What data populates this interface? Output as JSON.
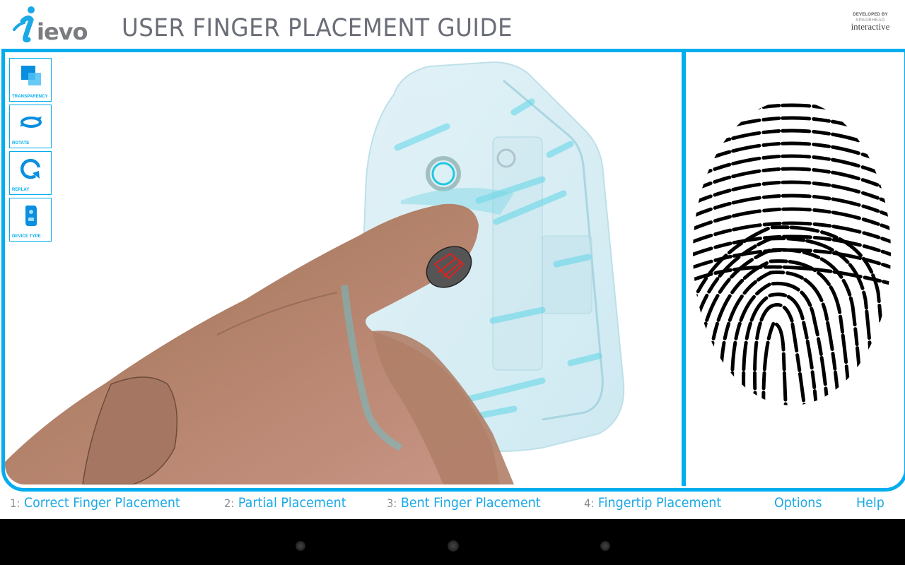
{
  "header": {
    "logo_text": "ievo",
    "title": "USER FINGER PLACEMENT GUIDE",
    "developer": {
      "line1": "DEVELOPED BY",
      "line2": "SPEARHEAD",
      "line3": "interactive"
    }
  },
  "toolbar": {
    "buttons": [
      {
        "label": "TRANSPARENCY",
        "icon": "transparency-icon"
      },
      {
        "label": "ROTATE",
        "icon": "rotate-icon"
      },
      {
        "label": "REPLAY",
        "icon": "replay-icon"
      },
      {
        "label": "DEVICE TYPE",
        "icon": "device-type-icon"
      }
    ]
  },
  "viewport": {
    "scene": "3D hand with index finger placed on transparent iEVO fingerprint reader",
    "print_panel": "fingerprint image"
  },
  "nav": {
    "items": [
      {
        "num": "1:",
        "label": "Correct Finger Placement"
      },
      {
        "num": "2:",
        "label": "Partial Placement"
      },
      {
        "num": "3:",
        "label": "Bent Finger Placement"
      },
      {
        "num": "4:",
        "label": "Fingertip Placement"
      }
    ],
    "options_label": "Options",
    "help_label": "Help"
  },
  "colors": {
    "accent": "#00adef",
    "title_gray": "#6b6e78",
    "nav_blue": "#1aa8e6"
  }
}
